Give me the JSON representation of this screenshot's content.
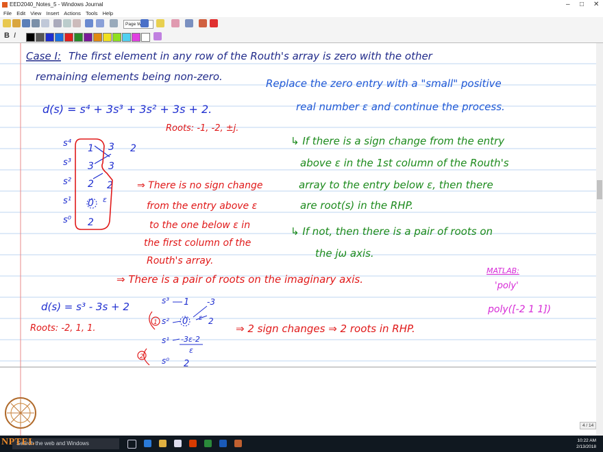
{
  "window": {
    "title": "EED2040_Notes_5 - Windows Journal",
    "controls": [
      "–",
      "□",
      "✕"
    ]
  },
  "menu": [
    "File",
    "Edit",
    "View",
    "Insert",
    "Actions",
    "Tools",
    "Help"
  ],
  "toolbar": {
    "zoom_value": "Page Width",
    "swatch_colors": [
      "#000000",
      "#555555",
      "#1f2fd0",
      "#1a6fe0",
      "#e02020",
      "#2a8a2a",
      "#7a1a9a",
      "#e08a10",
      "#f0e020",
      "#90e020",
      "#50d0f0",
      "#e040e0",
      "#ffffff"
    ]
  },
  "notes": {
    "case_title": "Case I:",
    "case_line1": "The first element in any row of the Routh's array is zero with the other",
    "case_line2": "remaining elements being non-zero.",
    "replace_line1": "Replace the zero entry with a \"small\" positive",
    "replace_line2": "real number ε and continue the process.",
    "ds1": "d(s) = s⁴ + 3s³ + 3s² + 3s + 2.",
    "roots1": "Roots: -1, -2, ±j.",
    "if_line1": "↳ If there is a sign change from the entry",
    "if_line2": "above ε in the 1st column of the Routh's",
    "if_line3": "array to the entry below ε, then there",
    "if_line4": "are root(s) in the RHP.",
    "ifnot_line1": "↳ If not, then there is a pair of roots on",
    "ifnot_line2": "the jω axis.",
    "nosign_line1": "⇒ There is no sign change",
    "nosign_line2": "from the entry above ε",
    "nosign_line3": "to the one below ε in",
    "nosign_line4": "the first column of the",
    "nosign_line5": "Routh's array.",
    "pair_line": "⇒ There is a pair of roots on the imaginary axis.",
    "matlab_title": "MATLAB:",
    "matlab_poly": "'poly'",
    "matlab_cmd": "poly([-2  1  1])",
    "ds2": "d(s) = s³ - 3s + 2",
    "roots2": "Roots: -2, 1, 1.",
    "sign_changes": "⇒ 2 sign changes ⇒ 2 roots in RHP."
  },
  "routh1": {
    "powers": [
      "s⁴",
      "s³",
      "s²",
      "s¹",
      "s⁰"
    ],
    "col1": [
      "1",
      "3",
      "2",
      "0",
      "2"
    ],
    "col2": [
      "3",
      "3",
      "2"
    ],
    "col3": [
      "2"
    ],
    "eps": "ε"
  },
  "routh2": {
    "powers": [
      "s³",
      "s²",
      "s¹",
      "s⁰"
    ],
    "col1": [
      "1",
      "0",
      "-3ε-2",
      "ε",
      "2"
    ],
    "col2": [
      "-3",
      "2"
    ],
    "eps": "ε",
    "mark1": "1",
    "mark2": "2"
  },
  "page_indicator": "4 / 14",
  "taskbar": {
    "search_placeholder": "Search the web and Windows",
    "time": "10:22 AM",
    "date": "2/13/2018"
  },
  "logo_text": "NPTEL",
  "colors": {
    "rule_blue": "#a9c8ee",
    "margin_red": "#e88a8a",
    "ink_blue": "#1f2fd0",
    "ink_red": "#e01818",
    "ink_green": "#1c8a1c",
    "ink_magenta": "#d62ad6",
    "ink_darkblue": "#202a8a"
  }
}
